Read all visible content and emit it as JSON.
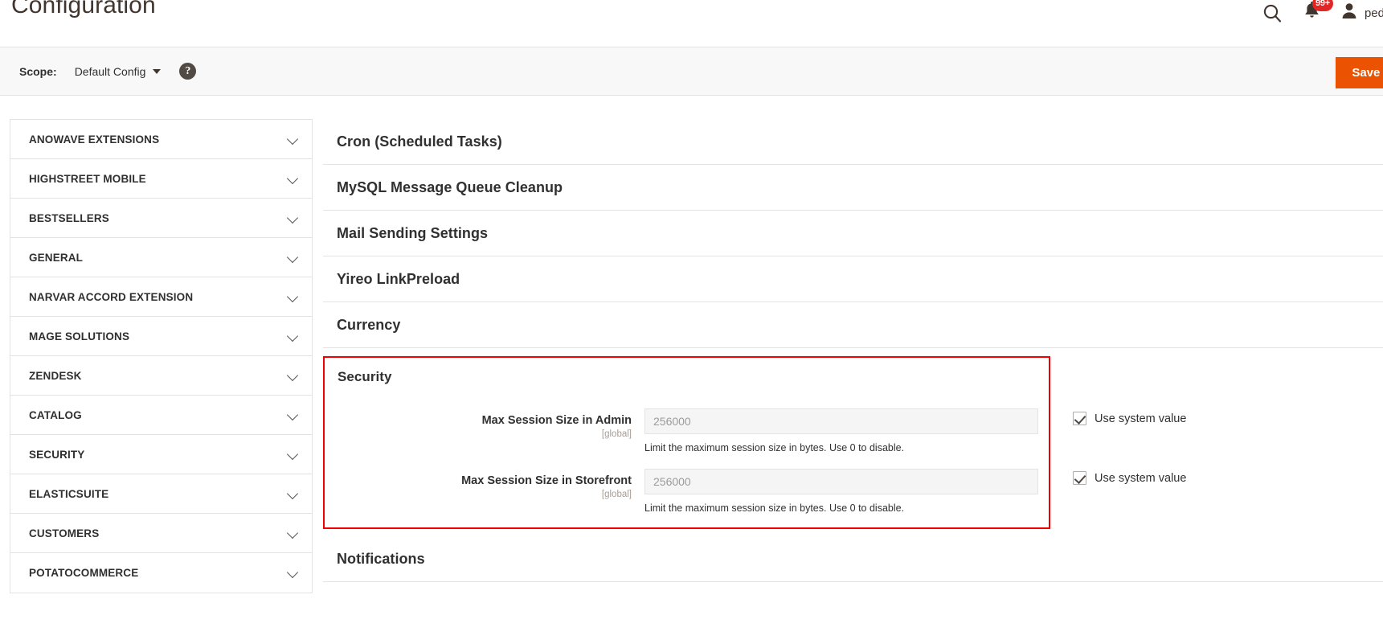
{
  "header": {
    "title": "Configuration",
    "search_icon": "search-icon",
    "notifications_icon": "bell-icon",
    "notifications_count": "99+",
    "user_icon": "user-avatar-icon",
    "user_name": "pedroli"
  },
  "scope_bar": {
    "label": "Scope:",
    "value": "Default Config",
    "help_icon": "?",
    "save_button": "Save Config"
  },
  "sidebar": {
    "items": [
      {
        "label": "ANOWAVE EXTENSIONS"
      },
      {
        "label": "HIGHSTREET MOBILE"
      },
      {
        "label": "BESTSELLERS"
      },
      {
        "label": "GENERAL"
      },
      {
        "label": "NARVAR ACCORD EXTENSION"
      },
      {
        "label": "MAGE SOLUTIONS"
      },
      {
        "label": "ZENDESK"
      },
      {
        "label": "CATALOG"
      },
      {
        "label": "SECURITY"
      },
      {
        "label": "ELASTICSUITE"
      },
      {
        "label": "CUSTOMERS"
      },
      {
        "label": "POTATOCOMMERCE"
      }
    ]
  },
  "main": {
    "sections_before": [
      {
        "title": "Cron (Scheduled Tasks)"
      },
      {
        "title": "MySQL Message Queue Cleanup"
      },
      {
        "title": "Mail Sending Settings"
      },
      {
        "title": "Yireo LinkPreload"
      },
      {
        "title": "Currency"
      }
    ],
    "highlighted_section": {
      "title": "Security",
      "highlight_color": "#f50000",
      "fields": [
        {
          "label": "Max Session Size in Admin",
          "scope": "[global]",
          "value": "256000",
          "note": "Limit the maximum session size in bytes. Use 0 to disable.",
          "use_system_value_label": "Use system value",
          "use_system_value_checked": true
        },
        {
          "label": "Max Session Size in Storefront",
          "scope": "[global]",
          "value": "256000",
          "note": "Limit the maximum session size in bytes. Use 0 to disable.",
          "use_system_value_label": "Use system value",
          "use_system_value_checked": true
        }
      ]
    },
    "sections_after": [
      {
        "title": "Notifications"
      }
    ]
  },
  "colors": {
    "accent_orange": "#eb5202",
    "highlight_red": "#f50000",
    "badge_red": "#e22626",
    "border_gray": "#e3e3e3",
    "text_dark": "#303030"
  }
}
